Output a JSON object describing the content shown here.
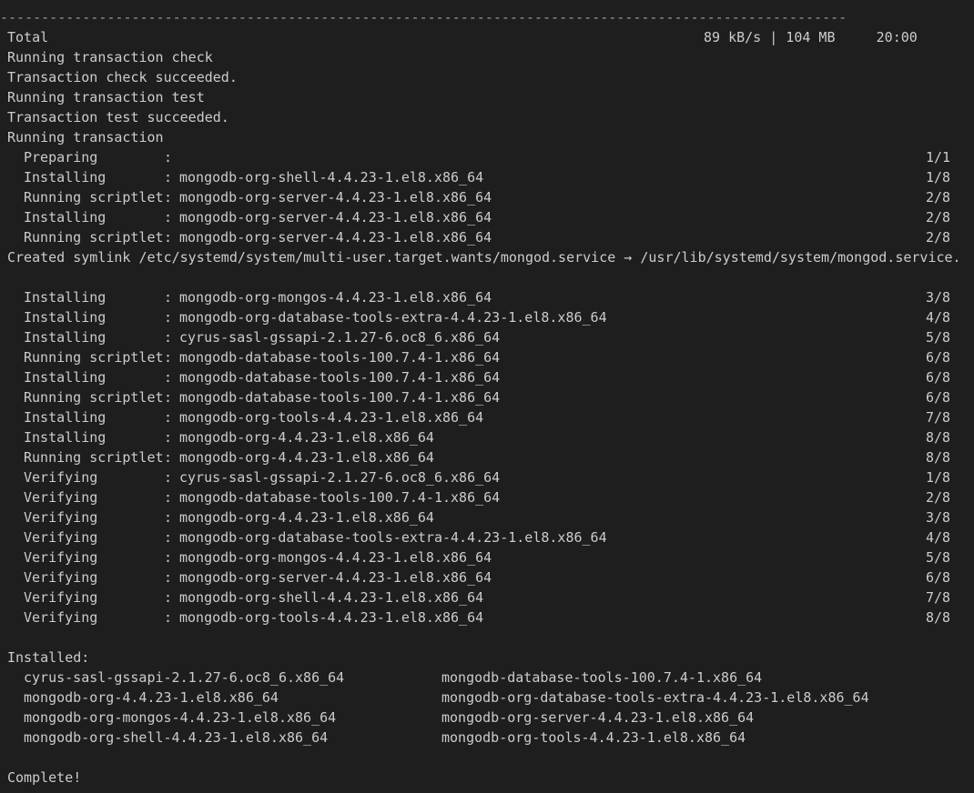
{
  "terminal": {
    "separator": "-------------------------------------------------------------------------------------------------------",
    "total_line": {
      "label": "Total",
      "stats": "89 kB/s | 104 MB     20:00"
    },
    "pre_lines": [
      "Running transaction check",
      "Transaction check succeeded.",
      "Running transaction test",
      "Transaction test succeeded.",
      "Running transaction"
    ],
    "steps_a": [
      {
        "action": "Preparing",
        "package": "",
        "progress": "1/1"
      },
      {
        "action": "Installing",
        "package": "mongodb-org-shell-4.4.23-1.el8.x86_64",
        "progress": "1/8"
      },
      {
        "action": "Running scriptlet",
        "package": "mongodb-org-server-4.4.23-1.el8.x86_64",
        "progress": "2/8"
      },
      {
        "action": "Installing",
        "package": "mongodb-org-server-4.4.23-1.el8.x86_64",
        "progress": "2/8"
      },
      {
        "action": "Running scriptlet",
        "package": "mongodb-org-server-4.4.23-1.el8.x86_64",
        "progress": "2/8"
      }
    ],
    "symlink_line": "Created symlink /etc/systemd/system/multi-user.target.wants/mongod.service → /usr/lib/systemd/system/mongod.service.",
    "steps_b": [
      {
        "action": "Installing",
        "package": "mongodb-org-mongos-4.4.23-1.el8.x86_64",
        "progress": "3/8"
      },
      {
        "action": "Installing",
        "package": "mongodb-org-database-tools-extra-4.4.23-1.el8.x86_64",
        "progress": "4/8"
      },
      {
        "action": "Installing",
        "package": "cyrus-sasl-gssapi-2.1.27-6.oc8_6.x86_64",
        "progress": "5/8"
      },
      {
        "action": "Running scriptlet",
        "package": "mongodb-database-tools-100.7.4-1.x86_64",
        "progress": "6/8"
      },
      {
        "action": "Installing",
        "package": "mongodb-database-tools-100.7.4-1.x86_64",
        "progress": "6/8"
      },
      {
        "action": "Running scriptlet",
        "package": "mongodb-database-tools-100.7.4-1.x86_64",
        "progress": "6/8"
      },
      {
        "action": "Installing",
        "package": "mongodb-org-tools-4.4.23-1.el8.x86_64",
        "progress": "7/8"
      },
      {
        "action": "Installing",
        "package": "mongodb-org-4.4.23-1.el8.x86_64",
        "progress": "8/8"
      },
      {
        "action": "Running scriptlet",
        "package": "mongodb-org-4.4.23-1.el8.x86_64",
        "progress": "8/8"
      },
      {
        "action": "Verifying",
        "package": "cyrus-sasl-gssapi-2.1.27-6.oc8_6.x86_64",
        "progress": "1/8"
      },
      {
        "action": "Verifying",
        "package": "mongodb-database-tools-100.7.4-1.x86_64",
        "progress": "2/8"
      },
      {
        "action": "Verifying",
        "package": "mongodb-org-4.4.23-1.el8.x86_64",
        "progress": "3/8"
      },
      {
        "action": "Verifying",
        "package": "mongodb-org-database-tools-extra-4.4.23-1.el8.x86_64",
        "progress": "4/8"
      },
      {
        "action": "Verifying",
        "package": "mongodb-org-mongos-4.4.23-1.el8.x86_64",
        "progress": "5/8"
      },
      {
        "action": "Verifying",
        "package": "mongodb-org-server-4.4.23-1.el8.x86_64",
        "progress": "6/8"
      },
      {
        "action": "Verifying",
        "package": "mongodb-org-shell-4.4.23-1.el8.x86_64",
        "progress": "7/8"
      },
      {
        "action": "Verifying",
        "package": "mongodb-org-tools-4.4.23-1.el8.x86_64",
        "progress": "8/8"
      }
    ],
    "installed_header": "Installed:",
    "installed": [
      [
        "cyrus-sasl-gssapi-2.1.27-6.oc8_6.x86_64",
        "mongodb-database-tools-100.7.4-1.x86_64"
      ],
      [
        "mongodb-org-4.4.23-1.el8.x86_64",
        "mongodb-org-database-tools-extra-4.4.23-1.el8.x86_64"
      ],
      [
        "mongodb-org-mongos-4.4.23-1.el8.x86_64",
        "mongodb-org-server-4.4.23-1.el8.x86_64"
      ],
      [
        "mongodb-org-shell-4.4.23-1.el8.x86_64",
        "mongodb-org-tools-4.4.23-1.el8.x86_64"
      ]
    ],
    "complete": "Complete!"
  }
}
